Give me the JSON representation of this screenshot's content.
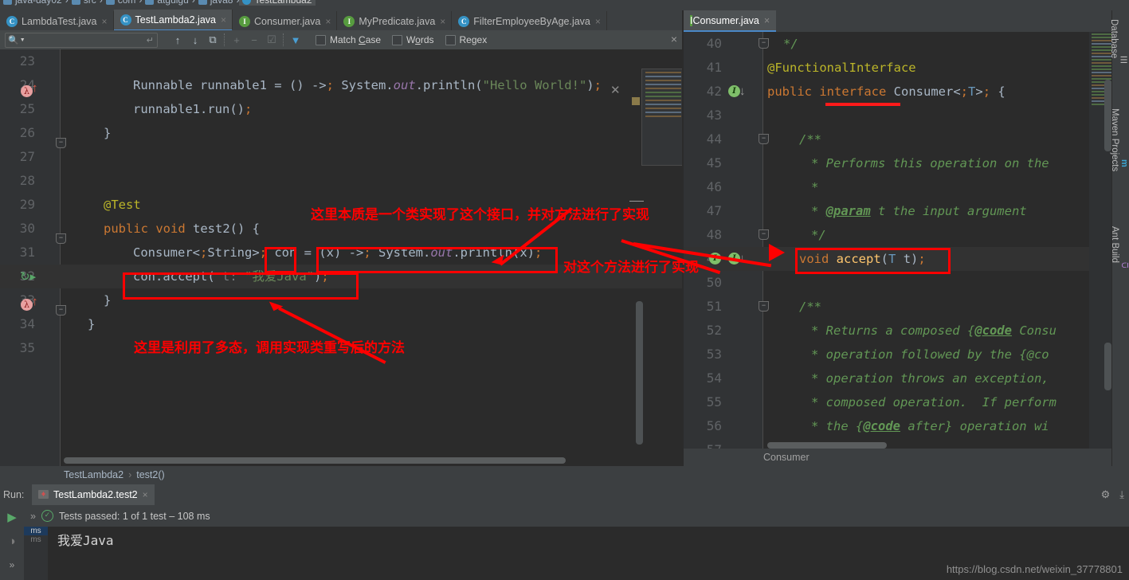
{
  "breadcrumb_top": [
    {
      "label": "java-day02",
      "icon": "module-icon"
    },
    {
      "label": "src",
      "icon": "folder-icon"
    },
    {
      "label": "com",
      "icon": "folder-icon"
    },
    {
      "label": "atguigu",
      "icon": "folder-icon"
    },
    {
      "label": "java8",
      "icon": "folder-icon"
    },
    {
      "label": "TestLambda2",
      "icon": "class-icon"
    }
  ],
  "tabs": [
    {
      "label": "LambdaTest.java",
      "icon": "class-icon",
      "kind": "c",
      "selected": false
    },
    {
      "label": "TestLambda2.java",
      "icon": "class-icon",
      "kind": "c",
      "selected": true
    },
    {
      "label": "Consumer.java",
      "icon": "interface-icon",
      "kind": "i",
      "selected": false
    },
    {
      "label": "MyPredicate.java",
      "icon": "interface-icon",
      "kind": "i",
      "selected": false
    },
    {
      "label": "FilterEmployeeByAge.java",
      "icon": "class-icon",
      "kind": "c",
      "selected": false
    }
  ],
  "tab_overflow_count": "1",
  "find": {
    "placeholder": "",
    "value": "",
    "search_icon": "magnifier-icon",
    "enter_icon": "return-icon",
    "buttons": [
      {
        "name": "find-previous",
        "glyph": "↑",
        "dim": false
      },
      {
        "name": "find-next",
        "glyph": "↓",
        "dim": false
      },
      {
        "name": "select-all-occurrences",
        "glyph": "⧉",
        "dim": false
      },
      {
        "name": "add-selection-next",
        "glyph": "+",
        "dim": true
      },
      {
        "name": "remove-selection",
        "glyph": "−",
        "dim": true
      },
      {
        "name": "select-all-lines",
        "glyph": "☑",
        "dim": true
      },
      {
        "name": "filter",
        "glyph": "▼",
        "dim": false
      }
    ],
    "options": [
      {
        "label": "Match Case",
        "mnemonic": "C",
        "checked": false
      },
      {
        "label": "Words",
        "mnemonic": "o",
        "checked": false
      },
      {
        "label": "Regex",
        "mnemonic": "",
        "checked": false
      }
    ],
    "close_glyph": "×"
  },
  "left_editor": {
    "file": "TestLambda2.java",
    "lines": [
      {
        "num": "23",
        "code": "",
        "indent": 0,
        "highlight": false
      },
      {
        "num": "24",
        "code": "Runnable runnable1 = () -> System.out.println(\"Hello World!\");",
        "indent": 75,
        "highlight": false
      },
      {
        "num": "25",
        "code": "runnable1.run();",
        "indent": 75,
        "highlight": false
      },
      {
        "num": "26",
        "code": "}",
        "indent": 38,
        "highlight": false
      },
      {
        "num": "27",
        "code": "",
        "indent": 0,
        "highlight": false
      },
      {
        "num": "28",
        "code": "",
        "indent": 0,
        "highlight": false
      },
      {
        "num": "29",
        "code": "@Test",
        "indent": 38,
        "highlight": false
      },
      {
        "num": "30",
        "code": "public void test2() {",
        "indent": 38,
        "highlight": false
      },
      {
        "num": "31",
        "code": "Consumer<String> con = (x) -> System.out.println(x);",
        "indent": 75,
        "highlight": false
      },
      {
        "num": "32",
        "code": "con.accept( t: \"我爱Java\");",
        "indent": 75,
        "highlight": true
      },
      {
        "num": "33",
        "code": "}",
        "indent": 38,
        "highlight": false
      },
      {
        "num": "34",
        "code": "}",
        "indent": 18,
        "highlight": false
      },
      {
        "num": "35",
        "code": "",
        "indent": 0,
        "highlight": false
      }
    ],
    "gutter_marks": [
      {
        "line": "24",
        "icon": "lambda-marker-icon",
        "arrow": "up-arrow-icon"
      },
      {
        "line": "30",
        "icon": "run-test-icon"
      },
      {
        "line": "31",
        "icon": "lambda-marker-icon",
        "arrow": "up-arrow-icon"
      }
    ],
    "breadcrumb": [
      "TestLambda2",
      "test2()"
    ],
    "breadcrumb_sep": "›"
  },
  "right_editor": {
    "tab": {
      "label": "Consumer.java",
      "icon": "interface-icon"
    },
    "lines": [
      {
        "num": "40",
        "code": "*/",
        "highlight": false,
        "indent": 20
      },
      {
        "num": "41",
        "code": "@FunctionalInterface",
        "highlight": false,
        "indent": 0
      },
      {
        "num": "42",
        "code": "public interface Consumer<T> {",
        "highlight": false,
        "indent": 0
      },
      {
        "num": "43",
        "code": "",
        "highlight": false,
        "indent": 0
      },
      {
        "num": "44",
        "code": "/**",
        "highlight": false,
        "indent": 40
      },
      {
        "num": "45",
        "code": "* Performs this operation on the",
        "highlight": false,
        "indent": 55
      },
      {
        "num": "46",
        "code": "*",
        "highlight": false,
        "indent": 55
      },
      {
        "num": "47",
        "code": "* @param t the input argument",
        "highlight": false,
        "indent": 55
      },
      {
        "num": "48",
        "code": "*/",
        "highlight": false,
        "indent": 55
      },
      {
        "num": "49",
        "code": "void accept(T t);",
        "highlight": true,
        "indent": 40
      },
      {
        "num": "50",
        "code": "",
        "highlight": false,
        "indent": 0
      },
      {
        "num": "51",
        "code": "/**",
        "highlight": false,
        "indent": 40
      },
      {
        "num": "52",
        "code": "* Returns a composed {@code Consu",
        "highlight": false,
        "indent": 55
      },
      {
        "num": "53",
        "code": "* operation followed by the {@co",
        "highlight": false,
        "indent": 55
      },
      {
        "num": "54",
        "code": "* operation throws an exception,",
        "highlight": false,
        "indent": 55
      },
      {
        "num": "55",
        "code": "* composed operation.  If perform",
        "highlight": false,
        "indent": 55
      },
      {
        "num": "56",
        "code": "* the {@code after} operation wi",
        "highlight": false,
        "indent": 55
      },
      {
        "num": "57",
        "code": "*",
        "highlight": false,
        "indent": 55
      }
    ],
    "gutter_marks": [
      {
        "line": "42",
        "icon": "implemented-interface-icon",
        "arrow": "down-arrow-icon"
      },
      {
        "line": "49",
        "icon": "implemented-method-icon",
        "arrow": "down-arrow-icon"
      }
    ],
    "status": "Consumer",
    "inspection_glyph": "✔"
  },
  "run_panel": {
    "label": "Run:",
    "tab": "TestLambda2.test2",
    "tab_close": "×",
    "result": "Tests passed: 1 of 1 test – 108 ms",
    "result_icon": "check-circle-icon",
    "expand_glyph": "»",
    "console_output": "我爱Java",
    "time_gutter": [
      "ms",
      "ms"
    ],
    "rail_buttons": [
      {
        "name": "rerun-button",
        "glyph": "▶"
      },
      {
        "name": "toggle-soft-wrap-button",
        "glyph": "◑"
      },
      {
        "name": "expand-button",
        "glyph": "»"
      }
    ],
    "tools": [
      {
        "name": "settings-icon",
        "glyph": "⚙"
      },
      {
        "name": "export-icon",
        "glyph": "⤓"
      }
    ]
  },
  "right_rail": [
    {
      "label": "Database",
      "icon": "database-icon",
      "glyph": "☰"
    },
    {
      "label": "Maven Projects",
      "icon": "maven-icon",
      "glyph": "m"
    },
    {
      "label": "Ant Build",
      "icon": "ant-icon",
      "glyph": "⁂"
    }
  ],
  "annotations": [
    {
      "id": "a1",
      "text": "这里本质是一个类实现了这个接口，并对方法进行了实现"
    },
    {
      "id": "a2",
      "text": "对这个方法进行了实现"
    },
    {
      "id": "a3",
      "text": "这里是利用了多态，调用实现类重写后的方法"
    }
  ],
  "watermark": "https://blog.csdn.net/weixin_37778801",
  "colors": {
    "annotation_red": "#ff0000",
    "accent_blue": "#4a88c7",
    "editor_bg": "#2b2b2b",
    "chrome_bg": "#3c3f41"
  }
}
